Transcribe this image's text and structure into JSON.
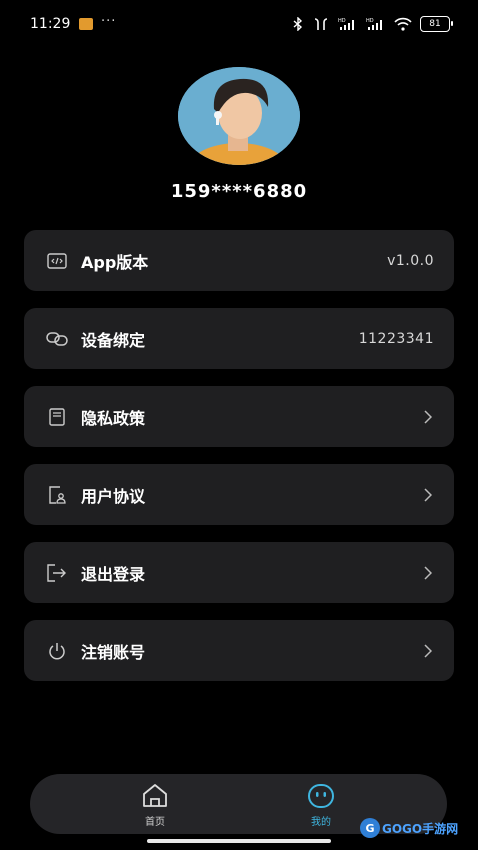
{
  "status_bar": {
    "time": "11:29",
    "more": "···",
    "battery": "81",
    "icons": [
      "app-notification-icon",
      "bluetooth-icon",
      "earbuds-icon",
      "hd-signal-icon",
      "hd-signal-icon",
      "wifi-icon",
      "battery-icon"
    ]
  },
  "profile": {
    "avatar_icon": "user-avatar-photo",
    "phone": "159****6880"
  },
  "menu": {
    "items": [
      {
        "label": "App版本",
        "value": "v1.0.0",
        "icon": "code-icon",
        "has_chevron": false
      },
      {
        "label": "设备绑定",
        "value": "11223341",
        "icon": "link-icon",
        "has_chevron": false
      },
      {
        "label": "隐私政策",
        "value": "",
        "icon": "document-icon",
        "has_chevron": true
      },
      {
        "label": "用户协议",
        "value": "",
        "icon": "user-agreement-icon",
        "has_chevron": true
      },
      {
        "label": "退出登录",
        "value": "",
        "icon": "logout-icon",
        "has_chevron": true
      },
      {
        "label": "注销账号",
        "value": "",
        "icon": "power-icon",
        "has_chevron": true
      }
    ]
  },
  "bottom_nav": {
    "tabs": [
      {
        "label": "首页",
        "icon": "home-icon",
        "active": false
      },
      {
        "label": "我的",
        "icon": "smiley-icon",
        "active": true
      }
    ]
  },
  "watermark": {
    "logo": "G",
    "text": "GOGO手游网"
  },
  "colors": {
    "background": "#000000",
    "card": "#1f1f21",
    "nav_bg": "#252528",
    "accent": "#3fb6e0"
  }
}
